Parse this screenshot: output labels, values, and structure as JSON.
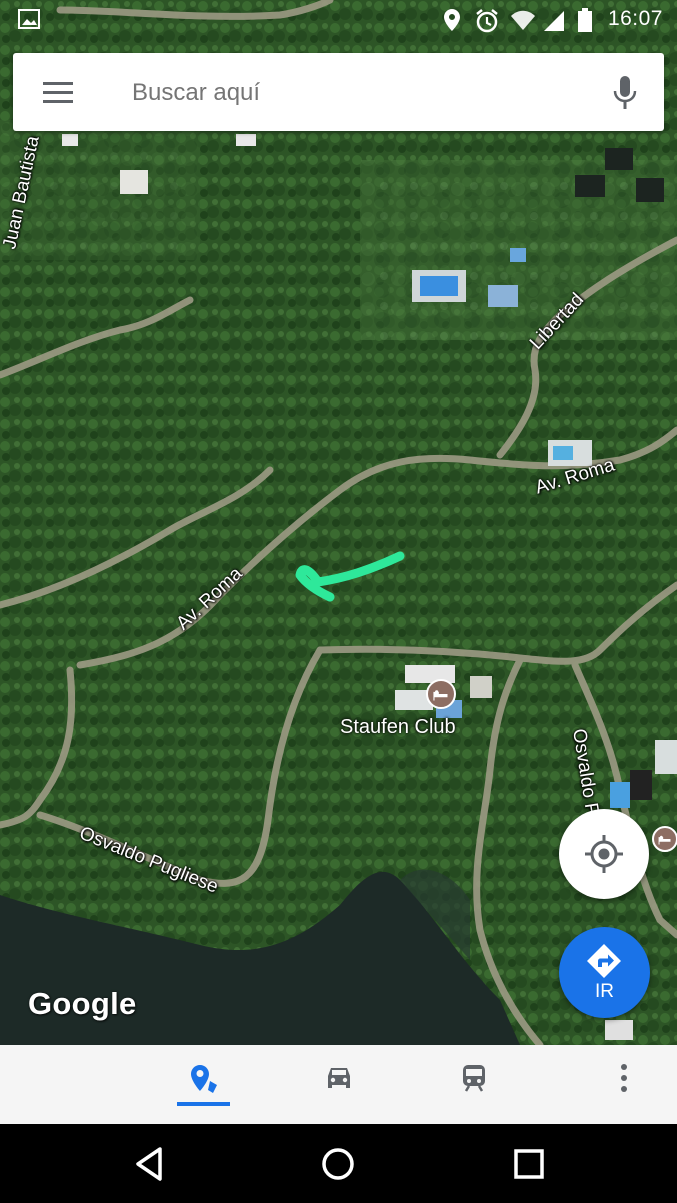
{
  "status_bar": {
    "time": "16:07",
    "icons": [
      "image-icon",
      "location-icon",
      "alarm-icon",
      "wifi-icon",
      "signal-icon",
      "battery-icon"
    ]
  },
  "search": {
    "placeholder": "Buscar aquí",
    "menu_icon": "hamburger-menu-icon",
    "mic_icon": "microphone-icon"
  },
  "map": {
    "street_labels": {
      "juan_bautista": "Juan Bautista",
      "libertad": "Libertad",
      "av_roma_right": "Av. Roma",
      "av_roma_left": "Av. Roma",
      "osvaldo_pugliese": "Osvaldo Pugliese",
      "osvaldo_p_right": "Osvaldo P"
    },
    "poi": {
      "name": "Staufen Club",
      "icon": "hotel-icon"
    },
    "annotation": "green-arrow-drawing",
    "logo": "Google"
  },
  "buttons": {
    "locate_icon": "my-location-icon",
    "go_label": "IR",
    "go_icon": "directions-icon"
  },
  "bottom_tabs": [
    {
      "name": "explore",
      "icon": "explore-pin-icon",
      "active": true
    },
    {
      "name": "driving",
      "icon": "car-icon",
      "active": false
    },
    {
      "name": "transit",
      "icon": "train-icon",
      "active": false
    },
    {
      "name": "more",
      "icon": "more-vertical-icon",
      "active": false
    }
  ],
  "nav_bar": {
    "icons": [
      "back-icon",
      "home-icon",
      "recents-icon"
    ]
  },
  "colors": {
    "accent": "#1a73e8",
    "vegetation": "#2f5a2a",
    "water": "#1e2a26",
    "road": "#a8a892",
    "annotation": "#2ee89a"
  }
}
